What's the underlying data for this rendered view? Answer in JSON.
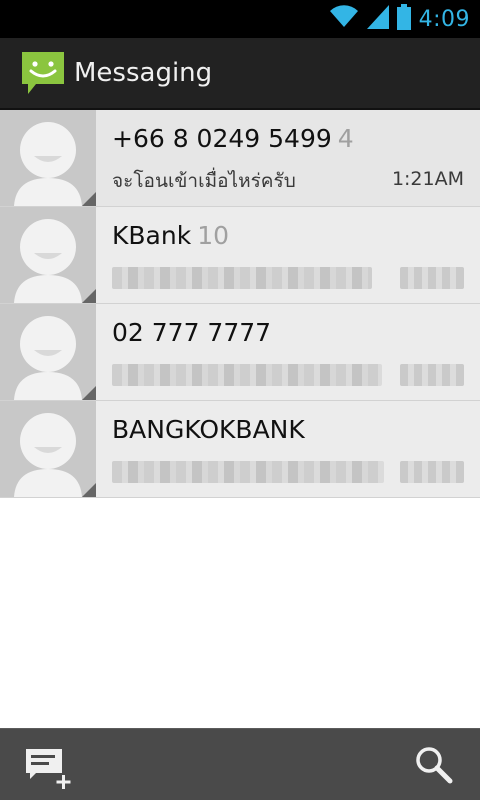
{
  "status_bar": {
    "time": "4:09",
    "icons": [
      "wifi-icon",
      "signal-icon",
      "battery-icon"
    ]
  },
  "action_bar": {
    "title": "Messaging",
    "icon": "messaging-app-icon"
  },
  "conversations": [
    {
      "name": "+66 8 0249 5499",
      "count": "4",
      "snippet": "จะโอนเข้าเมื่อไหร่ครับ",
      "time": "1:21AM"
    },
    {
      "name": "KBank",
      "count": "10",
      "snippet": "",
      "time": ""
    },
    {
      "name": "02 777 7777",
      "count": "",
      "snippet": "",
      "time": ""
    },
    {
      "name": "BANGKOKBANK",
      "count": "",
      "snippet": "",
      "time": ""
    }
  ],
  "bottom_bar": {
    "actions": [
      "compose-new-message",
      "search"
    ]
  },
  "colors": {
    "accent": "#33b5e5",
    "app_icon_green": "#8bc53f",
    "action_bar": "#222222",
    "bottom_bar": "#4a4a4a"
  }
}
